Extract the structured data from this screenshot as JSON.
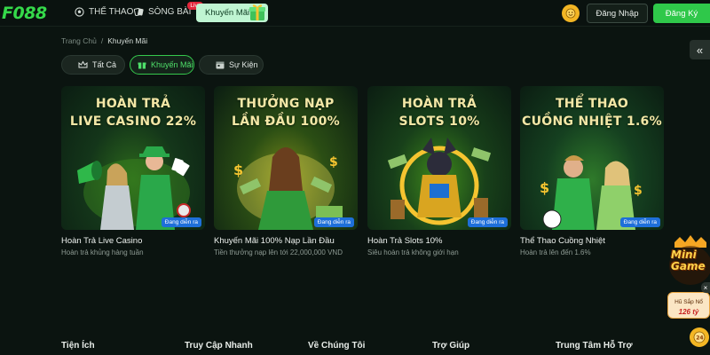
{
  "header": {
    "logo": "F088",
    "nav": [
      {
        "label": "THỂ THAO",
        "icon": "soccer-ball-icon"
      },
      {
        "label": "SÒNG BÀI",
        "icon": "cards-icon",
        "badge": "Live"
      }
    ],
    "promo_label": "Khuyến Mãi",
    "login_label": "Đăng Nhập",
    "register_label": "Đăng Ký"
  },
  "breadcrumb": {
    "home": "Trang Chủ",
    "separator": "/",
    "current": "Khuyến Mãi"
  },
  "tabs": [
    {
      "label": "Tất Cả",
      "icon": "crown-icon",
      "active": false
    },
    {
      "label": "Khuyến Mãi",
      "icon": "gift-icon",
      "active": true
    },
    {
      "label": "Sự Kiện",
      "icon": "calendar-icon",
      "active": false
    }
  ],
  "cards": [
    {
      "heading_line1": "HOÀN TRẢ",
      "heading_line2": "LIVE CASINO 22%",
      "badge": "Đang diễn ra",
      "title": "Hoàn Trả Live Casino",
      "description": "Hoàn trả khủng hàng tuần"
    },
    {
      "heading_line1": "THƯỞNG NẠP",
      "heading_line2": "LẦN ĐẦU 100%",
      "badge": "Đang diễn ra",
      "title": "Khuyến Mãi 100% Nạp Lần Đầu",
      "description": "Tiền thưởng nạp lên tới 22,000,000 VND"
    },
    {
      "heading_line1": "HOÀN TRẢ",
      "heading_line2": "SLOTS 10%",
      "badge": "Đang diễn ra",
      "title": "Hoàn Trả Slots 10%",
      "description": "Siêu hoàn trả không giới hạn"
    },
    {
      "heading_line1": "THỂ THAO",
      "heading_line2": "CUỒNG NHIỆT 1.6%",
      "badge": "Đang diễn ra",
      "title": "Thể Thao Cuồng Nhiệt",
      "description": "Hoàn trả lên đến 1.6%"
    }
  ],
  "footer": {
    "columns": [
      "Tiện Ích",
      "Truy Cập Nhanh",
      "Về Chúng Tôi",
      "Trợ Giúp",
      "Trung Tâm Hỗ Trợ"
    ]
  },
  "minigame": {
    "title_line1": "Mini",
    "title_line2": "Game",
    "jackpot_label": "Hũ Sắp Nổ",
    "jackpot_amount": "126 tỷ"
  },
  "colors": {
    "accent": "#2fc84a",
    "background": "#0b1410",
    "badge": "#1e6fd9",
    "heading": "#f3e7a6"
  }
}
